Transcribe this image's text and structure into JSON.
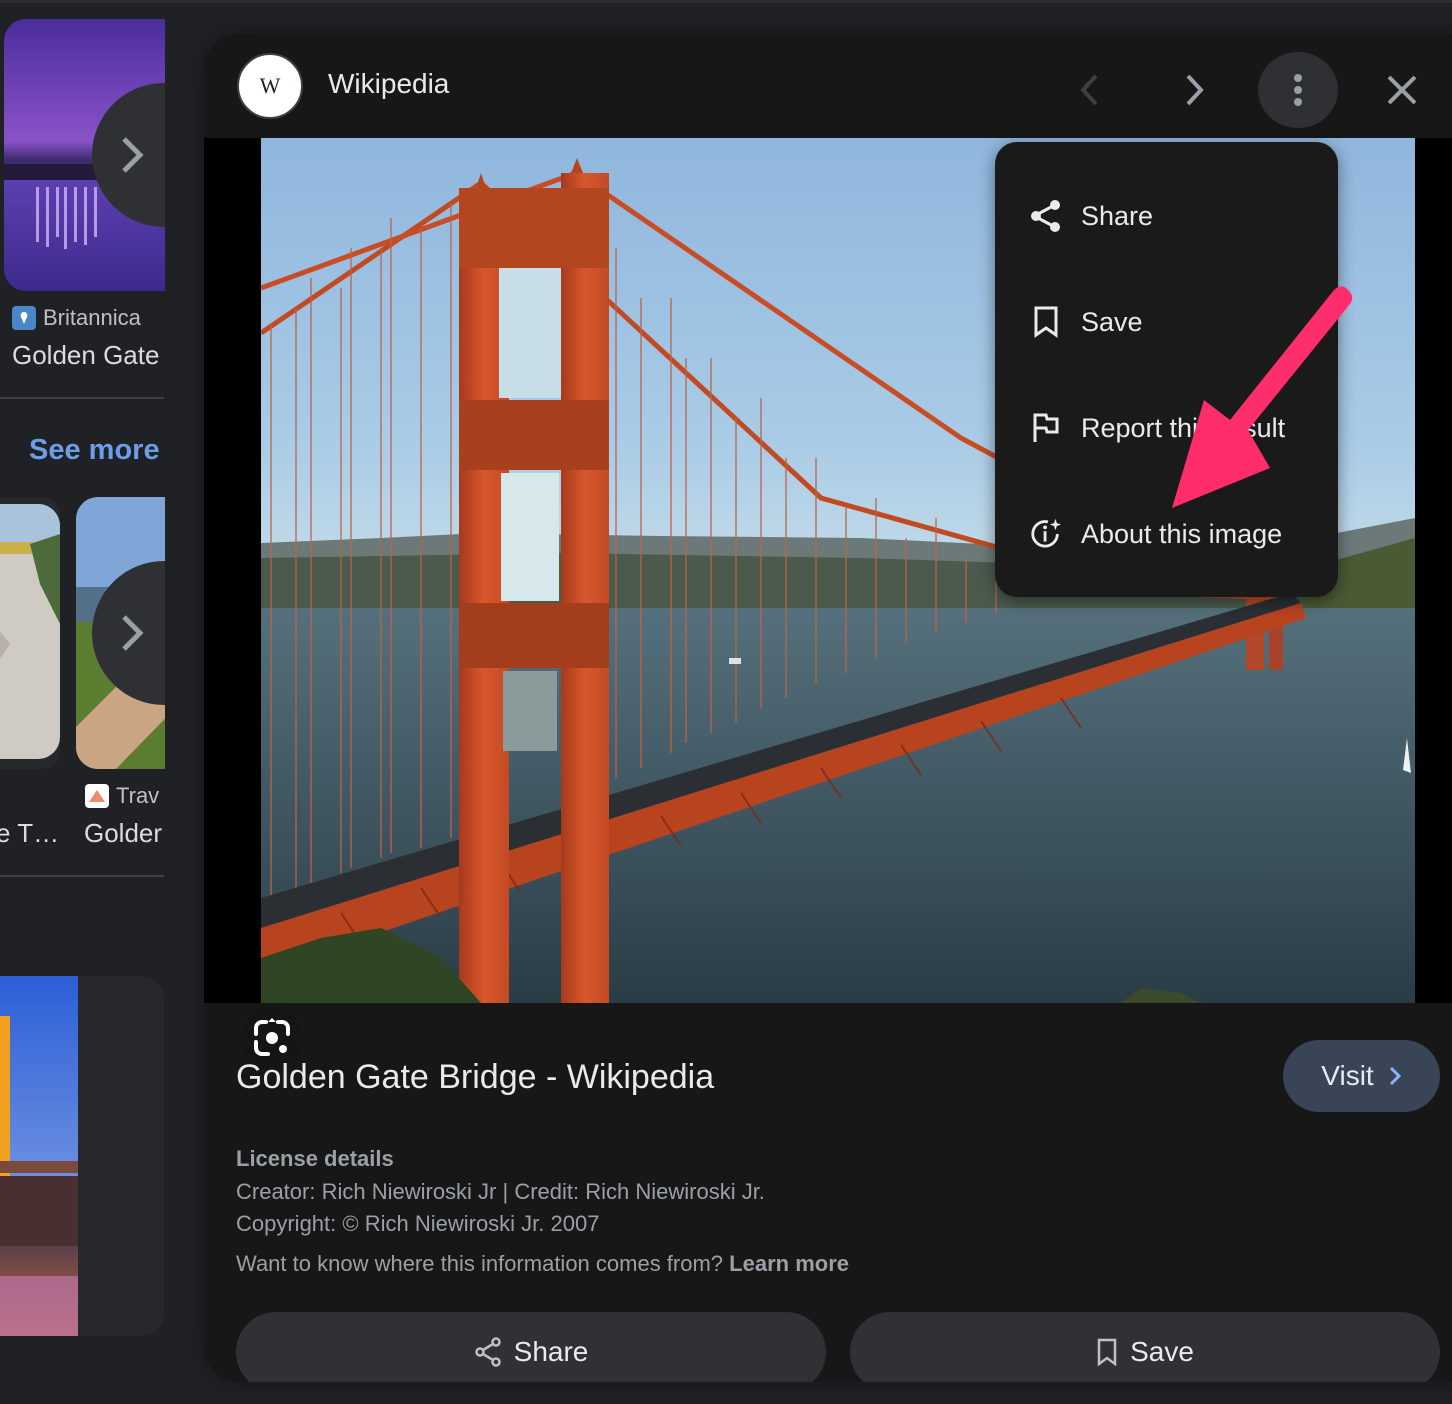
{
  "left_column": {
    "results": [
      {
        "source": "Britannica",
        "title": "Golden Gate",
        "favicon": "britannica-thistle-icon"
      },
      {
        "source": "Trav",
        "title": "Golder",
        "favicon": "travel-triangle-icon"
      }
    ],
    "truncated_title": "e T…",
    "see_more_label": "See more",
    "next_icon": "chevron-right-icon"
  },
  "panel": {
    "site_name": "Wikipedia",
    "site_logo_letter": "W",
    "header_buttons": {
      "prev": "chevron-left-icon",
      "next": "chevron-right-icon",
      "more": "more-vert-icon",
      "close": "close-icon"
    },
    "lens_icon": "google-lens-icon",
    "title": "Golden Gate Bridge - Wikipedia",
    "visit_label": "Visit",
    "license": {
      "heading": "License details",
      "creator_line": "Creator: Rich Niewiroski Jr | Credit: Rich Niewiroski Jr.",
      "copyright_line": "Copyright: © Rich Niewiroski Jr. 2007",
      "info_question": "Want to know where this information comes from?",
      "learn_more": "Learn more"
    },
    "actions": {
      "share_label": "Share",
      "save_label": "Save"
    }
  },
  "menu": {
    "items": [
      {
        "label": "Share",
        "icon": "share-icon"
      },
      {
        "label": "Save",
        "icon": "bookmark-icon"
      },
      {
        "label": "Report this result",
        "icon": "flag-icon"
      },
      {
        "label": "About this image",
        "icon": "about-image-icon"
      }
    ]
  },
  "colors": {
    "background": "#202124",
    "panel": "#171717",
    "menu": "#1a1a1a",
    "link_blue": "#6a9ee8",
    "visit_button": "#394457",
    "annotation_arrow": "#ff2d6b"
  }
}
